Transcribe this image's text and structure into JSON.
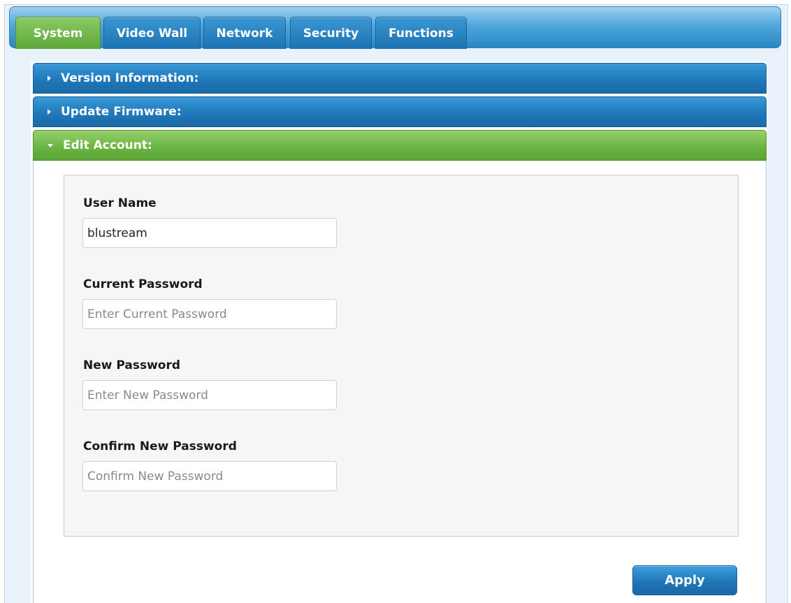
{
  "tabs": [
    {
      "label": "System",
      "active": true
    },
    {
      "label": "Video Wall",
      "active": false
    },
    {
      "label": "Network",
      "active": false
    },
    {
      "label": "Security",
      "active": false
    },
    {
      "label": "Functions",
      "active": false
    }
  ],
  "sections": [
    {
      "label": "Version Information:",
      "expanded": false
    },
    {
      "label": "Update Firmware:",
      "expanded": false
    },
    {
      "label": "Edit Account:",
      "expanded": true
    }
  ],
  "form": {
    "user_name": {
      "label": "User Name",
      "value": "blustream"
    },
    "current_password": {
      "label": "Current Password",
      "placeholder": "Enter Current Password"
    },
    "new_password": {
      "label": "New Password",
      "placeholder": "Enter New Password"
    },
    "confirm_password": {
      "label": "Confirm New Password",
      "placeholder": "Confirm New Password"
    },
    "apply_label": "Apply"
  },
  "colors": {
    "active_tab": "#6bb544",
    "inactive_tab": "#1f78bb",
    "accordion_closed": "#1f78bb",
    "accordion_open": "#6bb544",
    "apply_button": "#1f77b8"
  },
  "icons": {
    "collapsed": "caret-right-icon",
    "expanded": "caret-down-icon"
  }
}
